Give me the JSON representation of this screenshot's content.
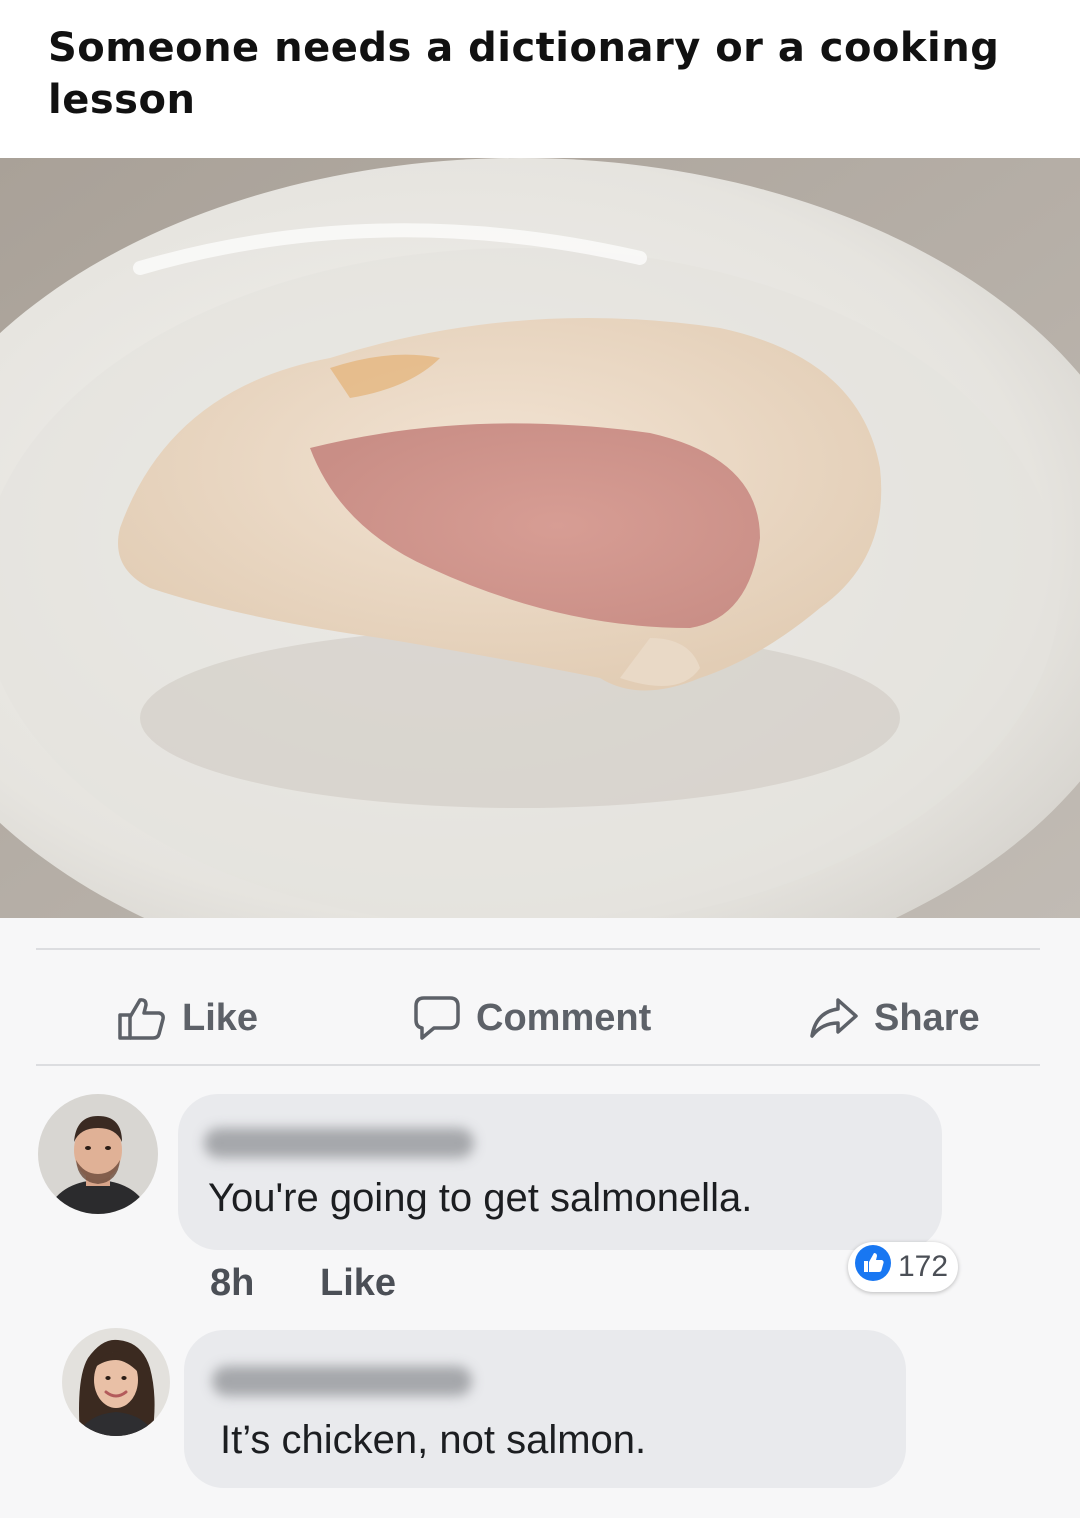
{
  "post": {
    "caption": "Someone needs a dictionary or a cooking lesson"
  },
  "actions": {
    "like_label": "Like",
    "comment_label": "Comment",
    "share_label": "Share"
  },
  "comments": [
    {
      "text": "You're going to get salmonella.",
      "time": "8h",
      "like_label": "Like",
      "reaction_count": "172"
    },
    {
      "text": "It’s chicken, not salmon."
    }
  ],
  "colors": {
    "facebook_blue": "#1877f2",
    "bubble_gray": "#e9eaed",
    "action_gray": "#5d6168"
  }
}
